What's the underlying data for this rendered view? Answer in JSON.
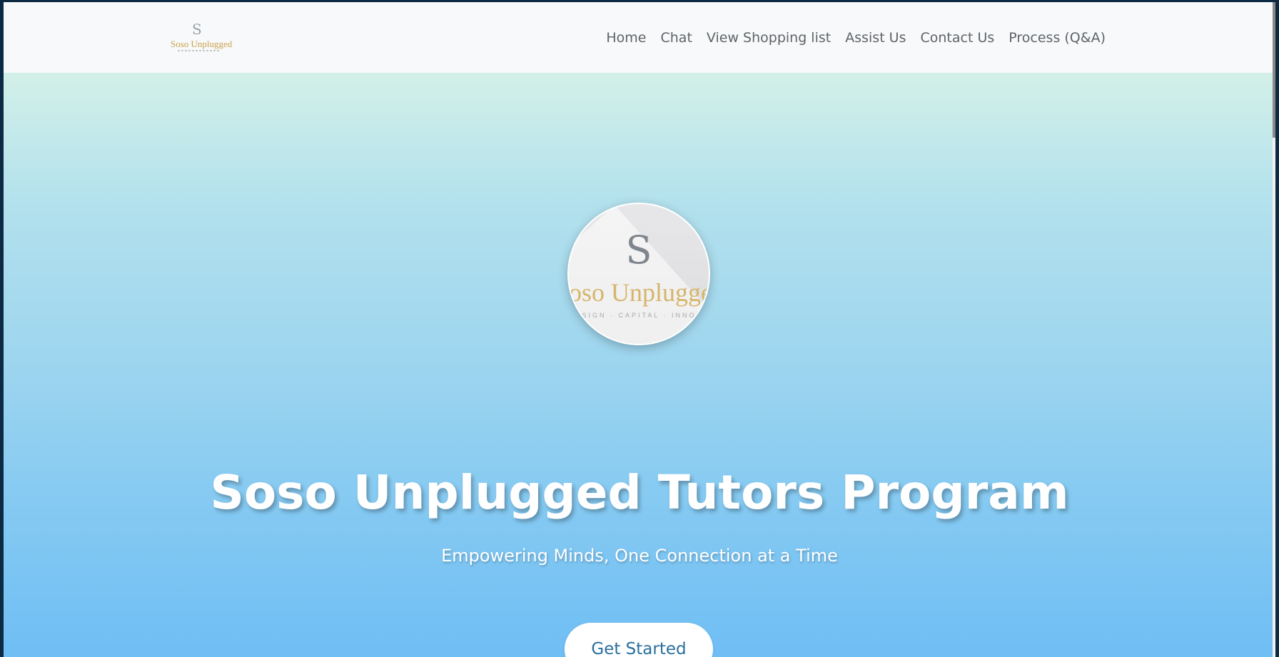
{
  "navbar": {
    "brand": {
      "initial": "S",
      "name": "Soso Unplugged"
    },
    "links": [
      {
        "label": "Home"
      },
      {
        "label": "Chat"
      },
      {
        "label": "View Shopping list"
      },
      {
        "label": "Assist Us"
      },
      {
        "label": "Contact Us"
      },
      {
        "label": "Process (Q&A)"
      }
    ]
  },
  "hero": {
    "logo": {
      "initial": "S",
      "name": "Soso Unplugged",
      "tagline": "DESIGN · CAPITAL · INNOVATE"
    },
    "title": "Soso Unplugged Tutors Program",
    "subtitle": "Empowering Minds, One Connection at a Time",
    "cta_label": "Get Started"
  },
  "colors": {
    "hero_top": "#d3f0e8",
    "hero_bottom": "#6fbef4",
    "cta_text": "#2a6f9e",
    "nav_text": "#5f6468",
    "brand_gold": "#c9a24a"
  }
}
